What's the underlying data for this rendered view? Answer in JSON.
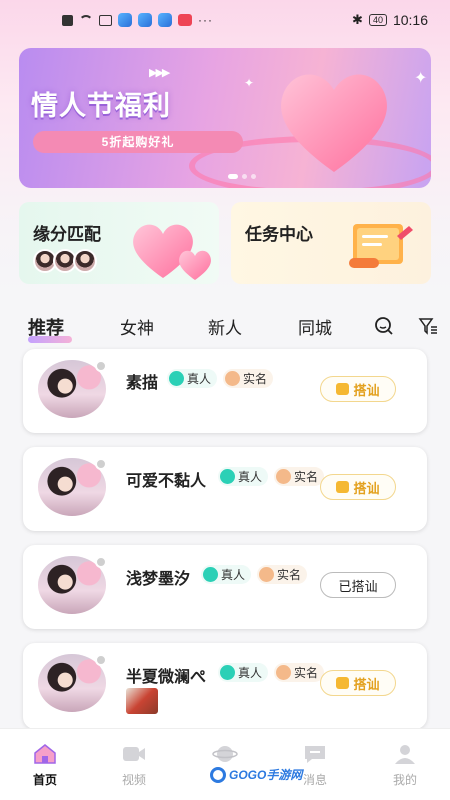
{
  "status_bar": {
    "time": "10:16",
    "battery": "40",
    "more": "···"
  },
  "banner": {
    "title": "情人节福利",
    "subtitle": "5折起购好礼",
    "arrows": "▶▶▶"
  },
  "features": {
    "match": {
      "title": "缘分匹配"
    },
    "task": {
      "title": "任务中心"
    }
  },
  "tabs": [
    {
      "label": "推荐",
      "active": true
    },
    {
      "label": "女神",
      "active": false
    },
    {
      "label": "新人",
      "active": false
    },
    {
      "label": "同城",
      "active": false
    }
  ],
  "tags": {
    "real": "真人",
    "verified": "实名"
  },
  "users": [
    {
      "name": "素描",
      "action": "搭讪",
      "greeted": false
    },
    {
      "name": "可爱不黏人",
      "action": "搭讪",
      "greeted": false
    },
    {
      "name": "浅梦墨汐",
      "action": "已搭讪",
      "greeted": true
    },
    {
      "name": "半夏微澜ぺ",
      "action": "搭讪",
      "greeted": false
    }
  ],
  "bottom_nav": [
    {
      "label": "首页",
      "icon": "home-icon",
      "active": true
    },
    {
      "label": "视频",
      "icon": "video-icon",
      "active": false
    },
    {
      "label": "",
      "icon": "planet-icon",
      "active": false
    },
    {
      "label": "消息",
      "icon": "message-icon",
      "active": false
    },
    {
      "label": "我的",
      "icon": "profile-icon",
      "active": false
    }
  ],
  "watermark": {
    "text": "GOGO手游网"
  },
  "colors": {
    "accent_gold": "#e3a11f",
    "verified_teal": "#2bd0b6",
    "tab_underline": "#b78cff"
  }
}
